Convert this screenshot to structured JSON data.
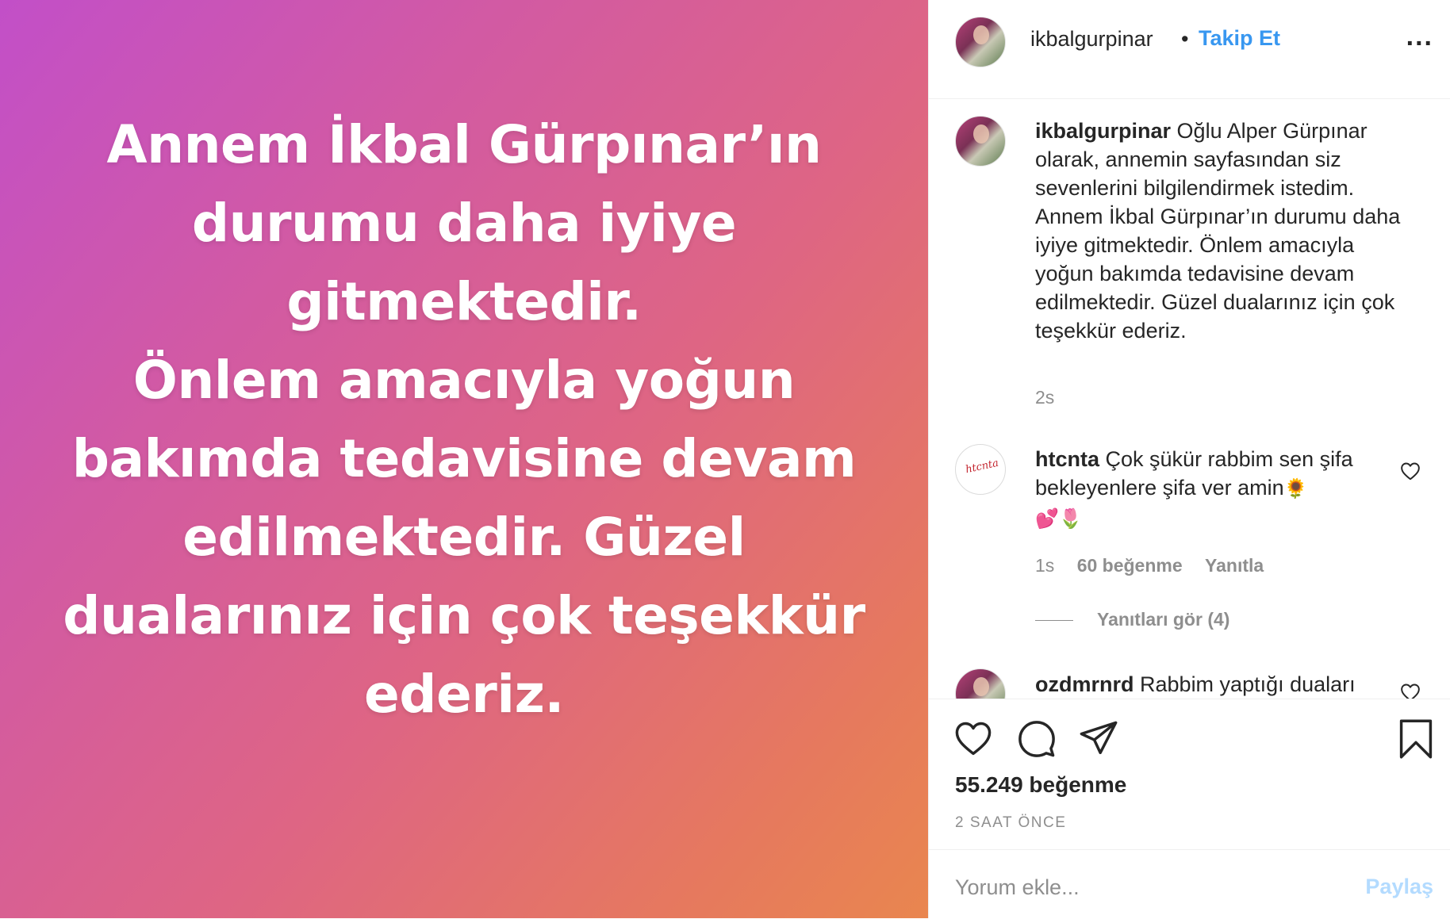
{
  "media": {
    "text": "Annem İkbal Gürpınar’ın\ndurumu daha iyiye\ngitmektedir.\nÖnlem amacıyla yoğun\nbakımda tedavisine devam\nedilmektedir. Güzel\ndualarınız için çok teşekkür\nederiz."
  },
  "header": {
    "username": "ikbalgurpinar",
    "separator": "•",
    "follow_label": "Takip Et",
    "more_label": "..."
  },
  "caption": {
    "username": "ikbalgurpinar",
    "text": "Oğlu Alper Gürpınar olarak, annemin sayfasından siz sevenlerini bilgilendirmek istedim. Annem İkbal Gürpınar’ın durumu daha iyiye gitmektedir. Önlem amacıyla yoğun bakımda tedavisine devam edilmektedir. Güzel dualarınız için çok teşekkür ederiz.",
    "age": "2s"
  },
  "comments": [
    {
      "username": "htcnta",
      "avatar_text": "htcnta",
      "text": "Çok şükür rabbim sen şifa bekleyenlere şifa ver amin",
      "emoji_inline": "🌻",
      "emoji_line": "💕🌷",
      "age": "1s",
      "likes": "60 beğenme",
      "reply_label": "Yanıtla",
      "view_replies": "Yanıtları gör (4)"
    },
    {
      "username": "ozdmrnrd",
      "text": "Rabbim yaptığı duaları"
    }
  ],
  "actions": {
    "like_icon": "heart-icon",
    "comment_icon": "comment-icon",
    "share_icon": "paper-plane-icon",
    "save_icon": "bookmark-icon",
    "likes_count": "55.249 beğenme",
    "timestamp": "2 SAAT ÖNCE"
  },
  "add_comment": {
    "placeholder": "Yorum ekle...",
    "post_label": "Paylaş"
  },
  "colors": {
    "accent": "#3897f0",
    "accent_disabled": "#b3dbff",
    "muted": "#8e8e8e",
    "text": "#262626",
    "gradient_start": "#c24fc8",
    "gradient_end": "#e9864f"
  }
}
